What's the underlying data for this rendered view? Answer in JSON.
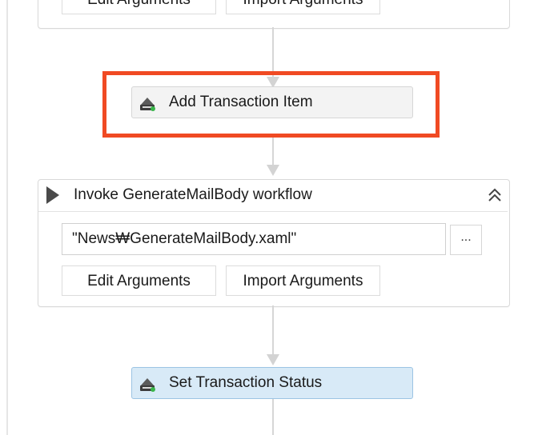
{
  "top_panel": {
    "edit_arguments_label": "Edit Arguments",
    "import_arguments_label": "Import Arguments"
  },
  "add_transaction_item": {
    "label": "Add Transaction Item",
    "icon": "queue-activity-icon"
  },
  "invoke_workflow": {
    "title": "Invoke GenerateMailBody workflow",
    "icon": "play-icon",
    "collapse_icon": "double-chevron-up-icon",
    "path_value": "\"News₩GenerateMailBody.xaml\"",
    "browse_label": "...",
    "edit_arguments_label": "Edit Arguments",
    "import_arguments_label": "Import Arguments"
  },
  "set_transaction_status": {
    "label": "Set Transaction Status",
    "icon": "queue-activity-icon"
  },
  "colors": {
    "highlight": "#f04a23",
    "selected_activity_bg": "#d8eaf7"
  }
}
